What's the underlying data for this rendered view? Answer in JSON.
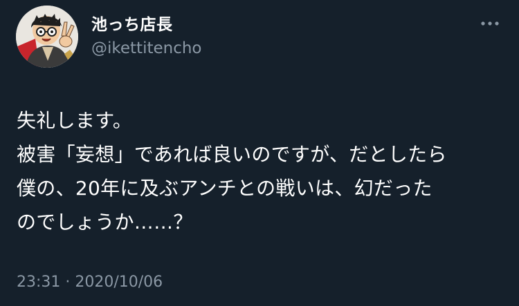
{
  "author": {
    "display_name": "池っち店長",
    "handle": "@ikettitencho",
    "avatar_icon": "cartoon-avatar-icon"
  },
  "menu": {
    "icon": "more-horizontal-icon"
  },
  "tweet": {
    "lines": [
      "失礼します。",
      "被害「妄想」であれば良いのですが、だとしたら",
      "僕の、20年に及ぶアンチとの戦いは、幻だった",
      "のでしょうか……？"
    ]
  },
  "meta": {
    "timestamp": "23:31 · 2020/10/06"
  },
  "colors": {
    "background": "#15202b",
    "text": "#ffffff",
    "secondary_text": "#8b98a5"
  }
}
